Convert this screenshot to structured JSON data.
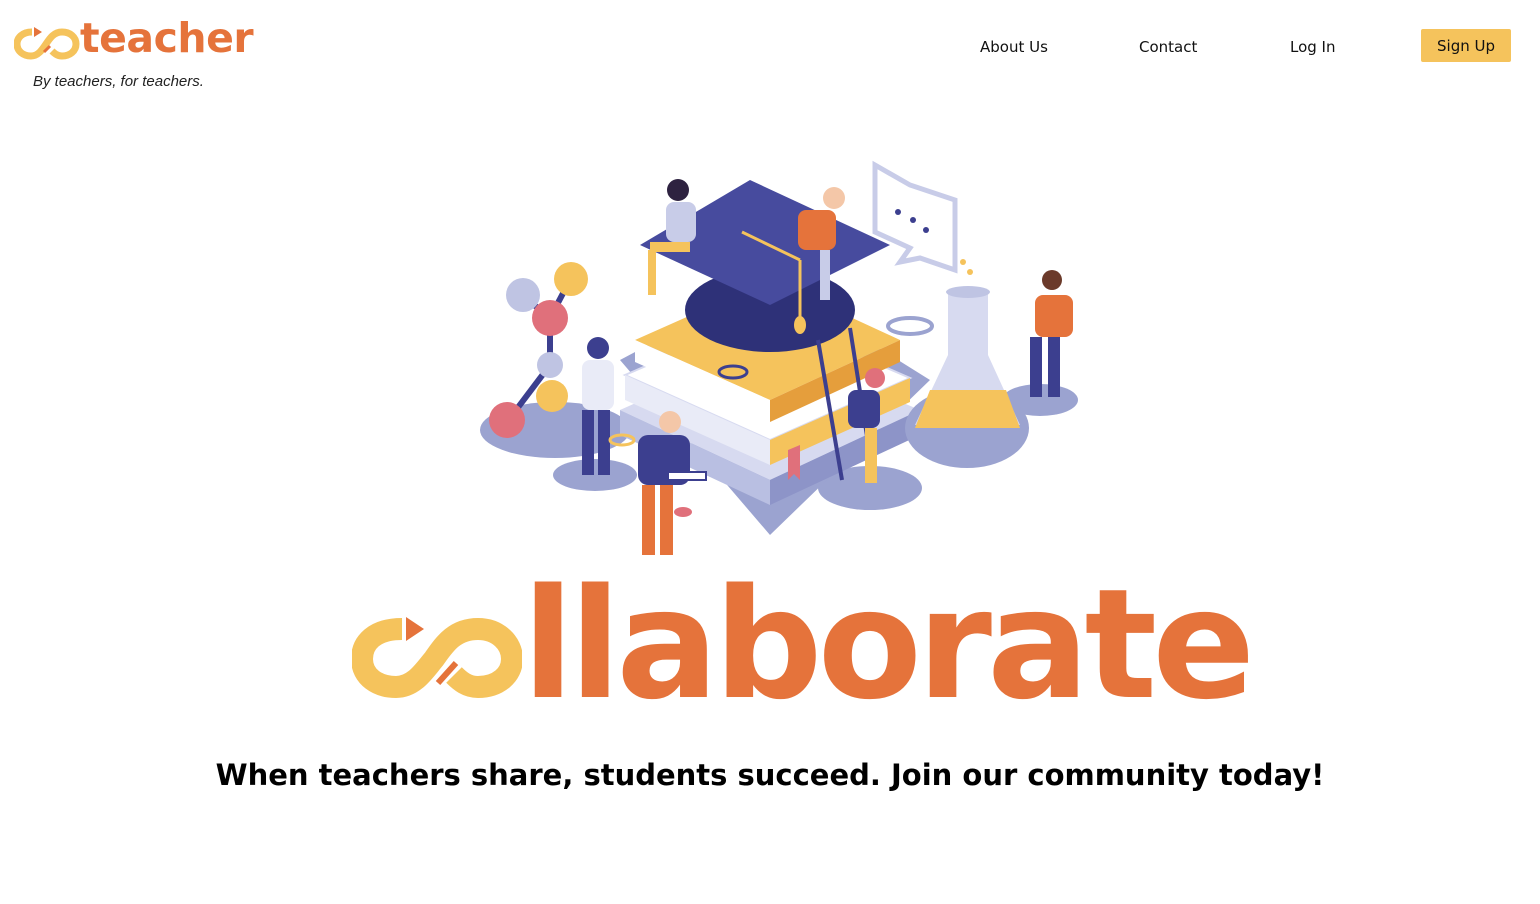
{
  "brand": {
    "logo_text": "teacher",
    "tagline": "By teachers, for teachers.",
    "logo_icon": "infinity-link-icon"
  },
  "nav": {
    "about_label": "About Us",
    "contact_label": "Contact",
    "login_label": "Log In",
    "signup_label": "Sign Up"
  },
  "hero": {
    "illustration_icon": "education-collaboration-illustration",
    "word_mark_icon": "infinity-link-icon",
    "word_text": "llaborate",
    "slogan": "When teachers share, students succeed. Join our community today!"
  },
  "colors": {
    "orange": "#E5733B",
    "yellow": "#F5C35C",
    "navy": "#3C3F8F",
    "lavender": "#9BA3D0"
  }
}
